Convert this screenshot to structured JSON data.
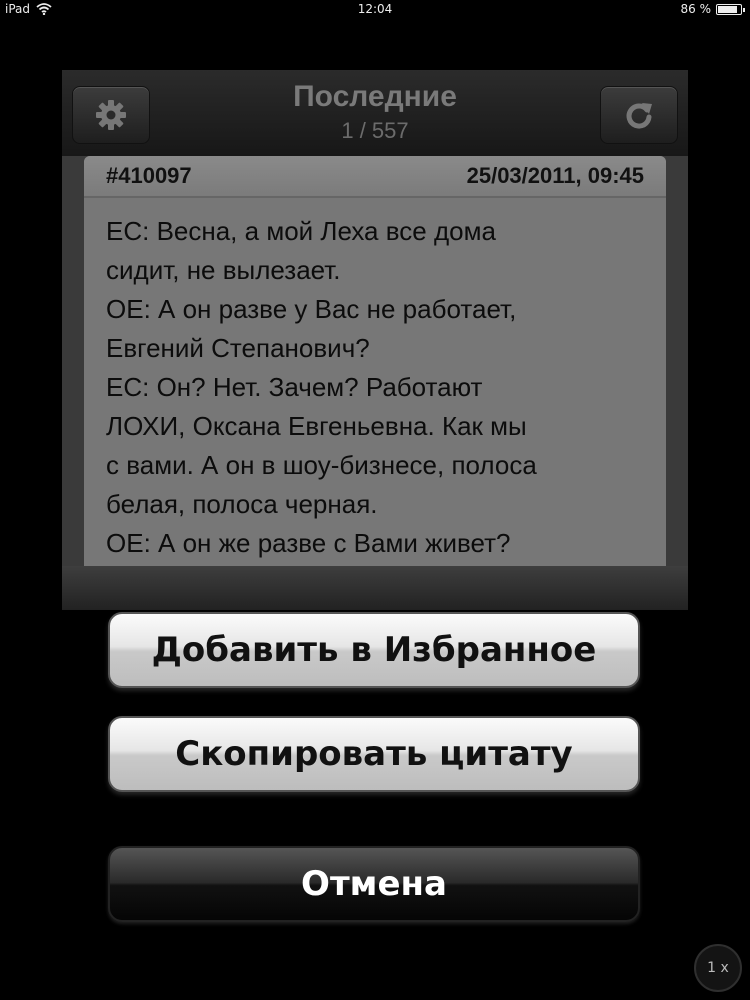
{
  "status_bar": {
    "device": "iPad",
    "time": "12:04",
    "battery": "86 %",
    "battery_level": 0.86
  },
  "navbar": {
    "title": "Последние",
    "subtitle": "1 / 557",
    "left_icon": "gear-icon",
    "right_icon": "refresh-icon"
  },
  "quote": {
    "id": "#410097",
    "date": "25/03/2011, 09:45",
    "lines": [
      "ЕС: Весна, а мой Леха все дома",
      "сидит, не вылезает.",
      "ОЕ: А он разве у Вас не работает,",
      "Евгений Степанович?",
      "ЕС: Он? Нет. Зачем? Работают",
      "ЛОХИ, Оксана Евгеньевна. Как мы",
      "с вами. А он в шоу-бизнесе, полоса",
      "белая, полоса черная.",
      "ОЕ: А он же разве с Вами живет?"
    ]
  },
  "action_sheet": {
    "add_favorite": "Добавить в Избранное",
    "copy_quote": "Скопировать цитату",
    "cancel": "Отмена"
  },
  "zoom_label": "1 x"
}
